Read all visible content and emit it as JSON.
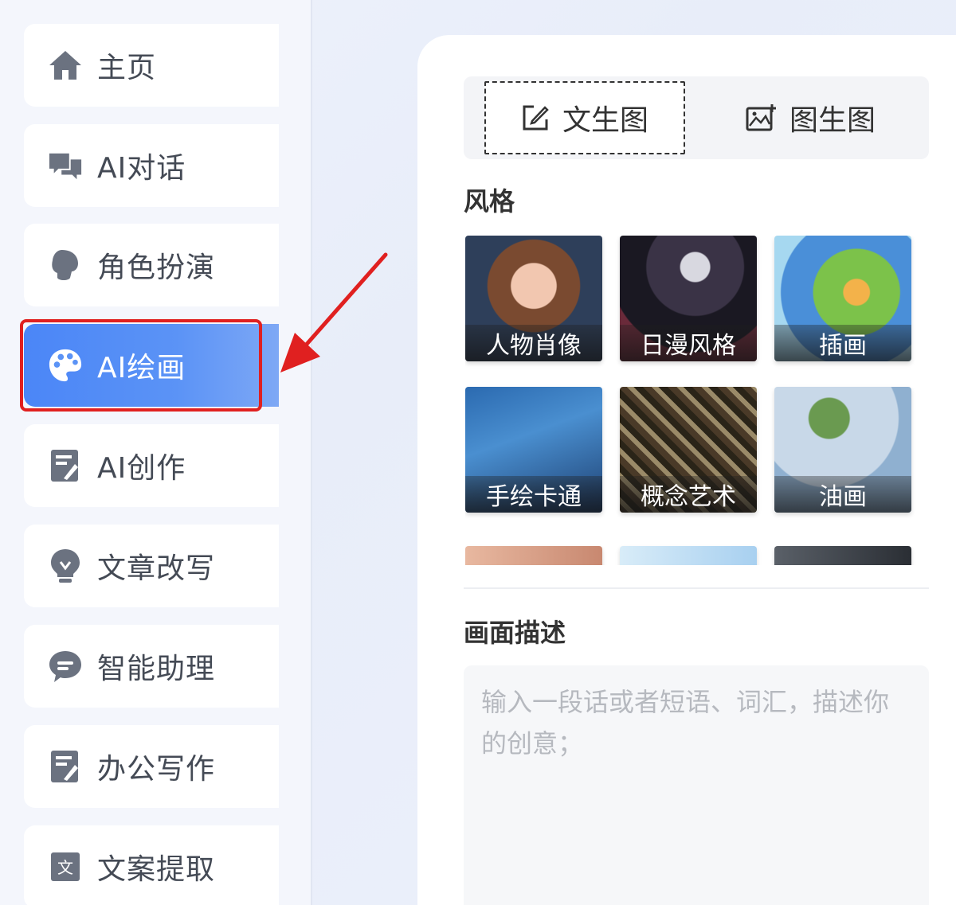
{
  "sidebar": {
    "items": [
      {
        "label": "主页",
        "icon": "home-icon"
      },
      {
        "label": "AI对话",
        "icon": "chat-bubbles-icon"
      },
      {
        "label": "角色扮演",
        "icon": "user-speak-icon"
      },
      {
        "label": "AI绘画",
        "icon": "palette-icon",
        "active": true
      },
      {
        "label": "AI创作",
        "icon": "edit-note-icon"
      },
      {
        "label": "文章改写",
        "icon": "lightbulb-icon"
      },
      {
        "label": "智能助理",
        "icon": "comment-icon"
      },
      {
        "label": "办公写作",
        "icon": "edit-note-icon"
      },
      {
        "label": "文案提取",
        "icon": "text-box-icon"
      }
    ]
  },
  "mode_tabs": [
    {
      "label": "文生图",
      "icon": "edit-square-icon",
      "selected": true
    },
    {
      "label": "图生图",
      "icon": "image-plus-icon",
      "selected": false
    }
  ],
  "styles": {
    "title": "风格",
    "items": [
      {
        "label": "人物肖像"
      },
      {
        "label": "日漫风格"
      },
      {
        "label": "插画"
      },
      {
        "label": "手绘卡通"
      },
      {
        "label": "概念艺术"
      },
      {
        "label": "油画"
      }
    ]
  },
  "description": {
    "title": "画面描述",
    "placeholder": "输入一段话或者短语、词汇，描述你的创意；"
  },
  "colors": {
    "accent": "#4b86f7",
    "annotation": "#e02020"
  }
}
